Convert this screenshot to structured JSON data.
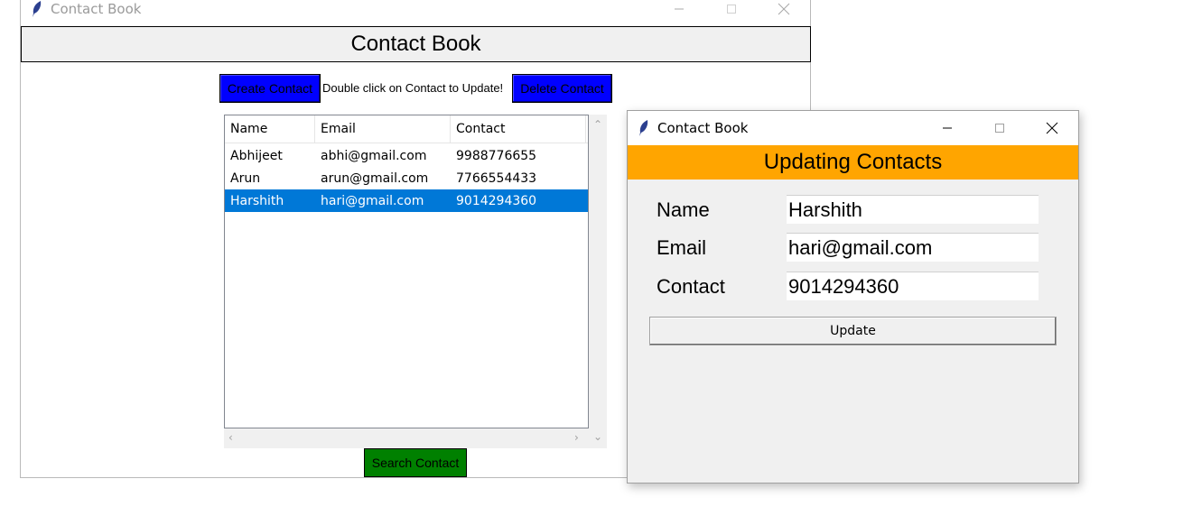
{
  "main_window": {
    "title": "Contact Book",
    "icon": "feather-icon",
    "header": "Contact Book",
    "create_button": "Create Contact",
    "hint": "Double click on Contact to Update!",
    "delete_button": "Delete Contact",
    "search_button": "Search Contact",
    "columns": [
      "Name",
      "Email",
      "Contact"
    ],
    "rows": [
      {
        "name": "Abhijeet",
        "email": "abhi@gmail.com",
        "contact": "9988776655"
      },
      {
        "name": "Arun",
        "email": "arun@gmail.com",
        "contact": "7766554433"
      },
      {
        "name": "Harshith",
        "email": "hari@gmail.com",
        "contact": "9014294360",
        "selected": true
      }
    ]
  },
  "update_window": {
    "title": "Contact Book",
    "icon": "feather-icon",
    "header": "Updating Contacts",
    "fields": {
      "name_label": "Name",
      "name_value": "Harshith",
      "email_label": "Email",
      "email_value": "hari@gmail.com",
      "contact_label": "Contact",
      "contact_value": "9014294360"
    },
    "update_button": "Update"
  },
  "colors": {
    "button_blue": "#0000ff",
    "button_green": "#008000",
    "header_orange": "#ffa500",
    "selection": "#0078d7"
  }
}
